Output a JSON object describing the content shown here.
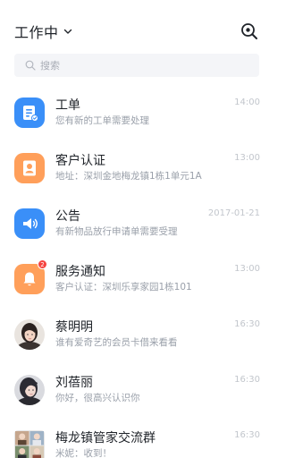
{
  "header": {
    "status_label": "工作中",
    "status_icon": "chevron-down-icon",
    "scan_icon": "scan-search-icon"
  },
  "search": {
    "placeholder": "搜索"
  },
  "colors": {
    "blue": "#3a8ff8",
    "orange": "#ff9f5a",
    "badge_red": "#f5433f",
    "title_text": "#1f2329",
    "sub_text": "#9aa0aa",
    "time_text": "#c2c6cc"
  },
  "messages": [
    {
      "title": "工单",
      "subtitle": "您有新的工单需要处理",
      "time": "14:00",
      "icon": "ticket-icon",
      "avatar_color": "blue"
    },
    {
      "title": "客户认证",
      "subtitle": "地址：深圳金地梅龙镇1栋1单元1A",
      "time": "13:00",
      "icon": "person-icon",
      "avatar_color": "orange"
    },
    {
      "title": "公告",
      "subtitle": "有新物品放行申请单需要受理",
      "time": "2017-01-21",
      "icon": "megaphone-icon",
      "avatar_color": "blue"
    },
    {
      "title": "服务通知",
      "subtitle": "客户认证：深圳乐享家园1栋101",
      "time": "13:00",
      "icon": "bell-icon",
      "avatar_color": "orange",
      "badge": "2"
    },
    {
      "title": "蔡明明",
      "subtitle": "谁有爱奇艺的会员卡借来看看",
      "time": "16:30",
      "icon": "user-photo-icon"
    },
    {
      "title": "刘蓓丽",
      "subtitle": "你好，很高兴认识你",
      "time": "16:30",
      "icon": "user-photo-icon"
    },
    {
      "title": "梅龙镇管家交流群",
      "subtitle": "米妮：收到！",
      "time": "16:30",
      "icon": "group-photo-icon"
    }
  ]
}
